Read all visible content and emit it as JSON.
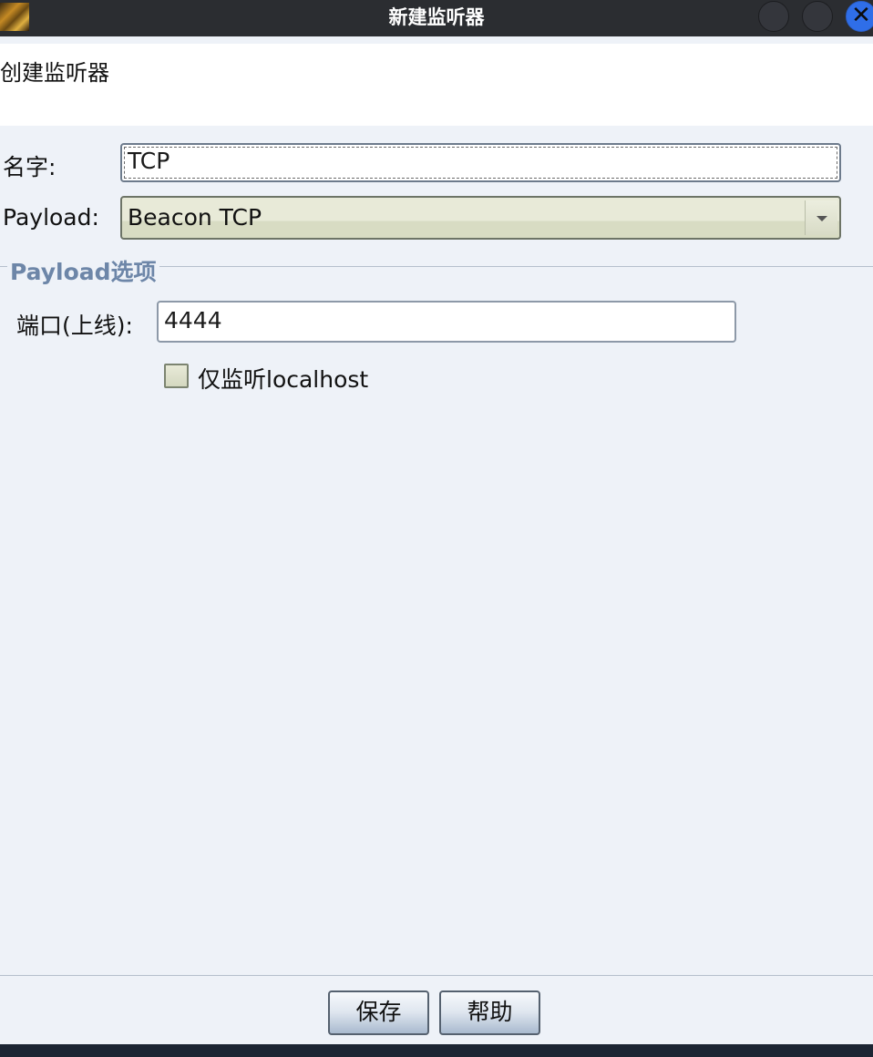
{
  "window": {
    "title": "新建监听器",
    "close_glyph": "✕"
  },
  "header": {
    "text": "创建监听器"
  },
  "form": {
    "name_label": "名字:",
    "name_value": "TCP",
    "payload_label": "Payload:",
    "payload_value": "Beacon TCP"
  },
  "options": {
    "group_title": "Payload选项",
    "port_label": "端口(上线):",
    "port_value": "4444",
    "localhost_label": "仅监听localhost",
    "localhost_checked": false
  },
  "buttons": {
    "save": "保存",
    "help": "帮助"
  },
  "icons": {
    "app_icon": "app-icon",
    "minimize": "minimize-icon",
    "maximize": "maximize-icon",
    "close": "close-icon",
    "dropdown": "chevron-down-icon"
  },
  "colors": {
    "titlebar": "#2b2d31",
    "close_button": "#2f6ee8",
    "group_title": "#6d86a8",
    "panel": "#eef2f8"
  }
}
